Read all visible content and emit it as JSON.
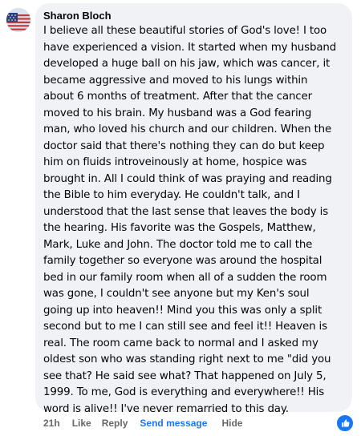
{
  "comment": {
    "author": "Sharon Bloch",
    "avatar_icon": "us-flag-avatar-icon",
    "lines": [
      "I believe all these beautiful stories of God's love! I too",
      "have experienced a vision. It started when my husband",
      "developed a huge ball on his jaw, which was cancer, it",
      "became aggressive and moved to his lungs within",
      "about 6 months of treatment. After that the cancer",
      "moved to his brain. My husband was a God fearing",
      "man, who loved his church and our children. When the",
      "doctor said that there's nothing they can do but keep",
      "him on fluids introveinously at home, hospice was",
      "brought in. All I could think of was praying and reading",
      "the Bible to him everyday. He couldn't talk, and I",
      "understood that the last sense that leaves the body is",
      "the hearing. His favorite was the Gospels, Matthew,",
      "Mark, Luke and John. The doctor told me to call the",
      "family together so everyone was around the hospital",
      "bed in our family room when all of a sudden the room",
      "was gone, I couldn't see anyone but my Ken's soul",
      "going up into heaven!! Mind you this was only a split",
      "second but to me I can still see and feel it!! Heaven is",
      "real. The room came back to normal and I asked my",
      "oldest son who was standing right next to me \"did you",
      "see that? He said see what? That happened on July 5,",
      "1999. To me, God is everything and everywhere!! His",
      "word is alive!! I've never remarried to this day."
    ]
  },
  "actions": {
    "time": "21h",
    "like": "Like",
    "reply": "Reply",
    "send_message": "Send message",
    "hide": "Hide"
  },
  "reaction": {
    "icon": "thumbs-up-icon",
    "color": "#1877f2"
  },
  "colors": {
    "bubble": "#f0f2f5",
    "text": "#050505",
    "meta": "#65676b",
    "link": "#1877f2"
  }
}
